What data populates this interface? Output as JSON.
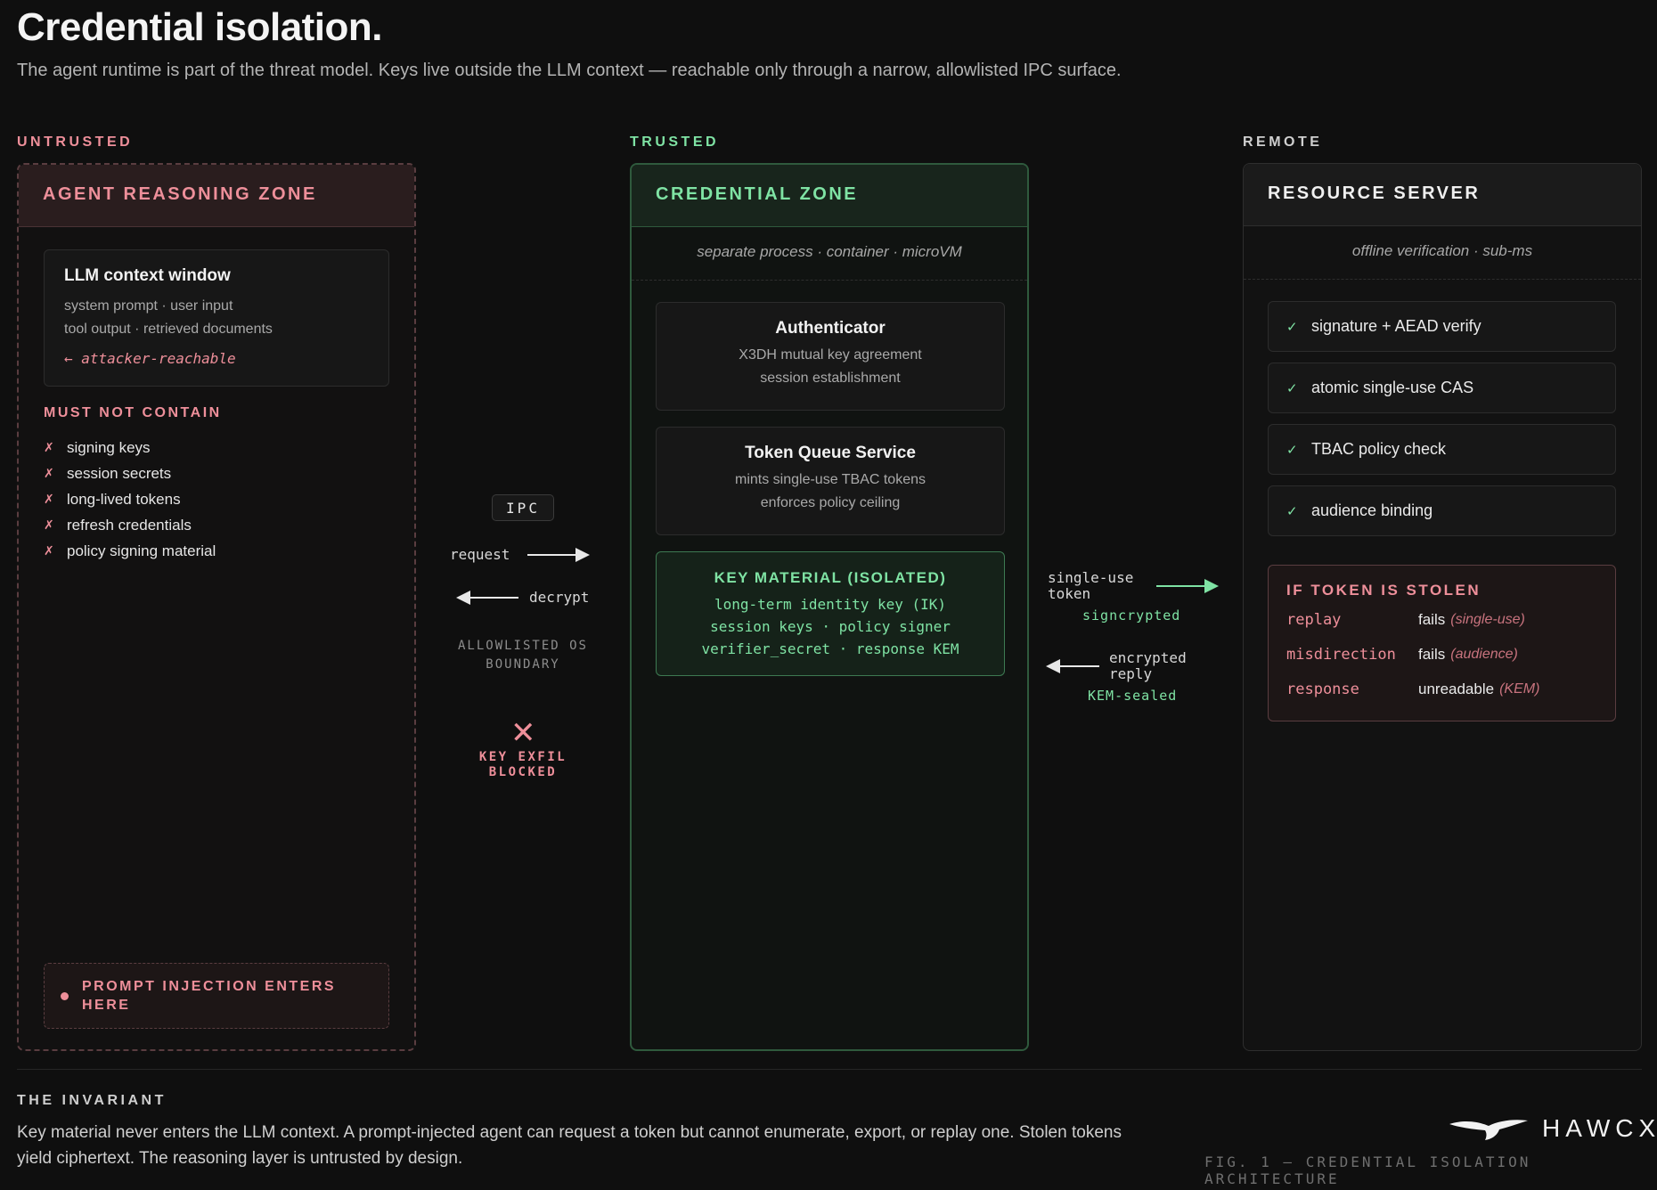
{
  "header": {
    "title": "Credential isolation.",
    "subtitle": "The agent runtime is part of the threat model. Keys live outside the LLM context — reachable only through a narrow, allowlisted IPC surface."
  },
  "zones": {
    "untrusted_label": "UNTRUSTED",
    "trusted_label": "TRUSTED",
    "remote_label": "REMOTE"
  },
  "agent_zone": {
    "title": "AGENT REASONING ZONE",
    "llm_box": {
      "title": "LLM context window",
      "line1": "system prompt · user input",
      "line2": "tool output · retrieved documents",
      "reachable": "← attacker-reachable"
    },
    "must_not_title": "MUST NOT CONTAIN",
    "must_not_items": [
      "signing keys",
      "session secrets",
      "long-lived tokens",
      "refresh credentials",
      "policy signing material"
    ],
    "must_not_mark": "✗",
    "prompt_injection": "PROMPT INJECTION ENTERS HERE"
  },
  "credential_zone": {
    "title": "CREDENTIAL ZONE",
    "note": "separate process · container · microVM",
    "authenticator": {
      "title": "Authenticator",
      "line1": "X3DH mutual key agreement",
      "line2": "session establishment"
    },
    "token_queue": {
      "title": "Token Queue Service",
      "line1": "mints single-use TBAC tokens",
      "line2": "enforces policy ceiling"
    },
    "key_material": {
      "title": "KEY MATERIAL (ISOLATED)",
      "line1": "long-term identity key (IK)",
      "line2": "session keys · policy signer",
      "line3": "verifier_secret · response KEM"
    }
  },
  "resource_server": {
    "title": "RESOURCE SERVER",
    "note": "offline verification · sub-ms",
    "check_mark": "✓",
    "checks": [
      "signature + AEAD verify",
      "atomic single-use CAS",
      "TBAC policy check",
      "audience binding"
    ],
    "stolen": {
      "title": "IF TOKEN IS STOLEN",
      "rows": [
        {
          "key": "replay",
          "value": "fails",
          "note": "(single-use)"
        },
        {
          "key": "misdirection",
          "value": "fails",
          "note": "(audience)"
        },
        {
          "key": "response",
          "value": "unreadable",
          "note": "(KEM)"
        }
      ]
    }
  },
  "ipc": {
    "badge": "IPC",
    "request": "request",
    "decrypt": "decrypt",
    "allowlisted": "ALLOWLISTED OS BOUNDARY",
    "exfil_mark": "✕",
    "exfil": "KEY EXFIL BLOCKED"
  },
  "remote_channel": {
    "token": "single-use token",
    "signcrypted": "signcrypted",
    "reply": "encrypted reply",
    "kem_sealed": "KEM-sealed"
  },
  "footer": {
    "invariant_title": "THE INVARIANT",
    "invariant_text": "Key material never enters the LLM context. A prompt-injected agent can request a token but cannot enumerate, export, or replay one. Stolen tokens yield ciphertext. The reasoning layer is untrusted by design.",
    "brand": "HAWCX",
    "caption": "FIG. 1 — CREDENTIAL ISOLATION ARCHITECTURE"
  },
  "colors": {
    "untrusted": "#ee8f9a",
    "trusted": "#7fe3a4",
    "background": "#0f0f0f"
  }
}
